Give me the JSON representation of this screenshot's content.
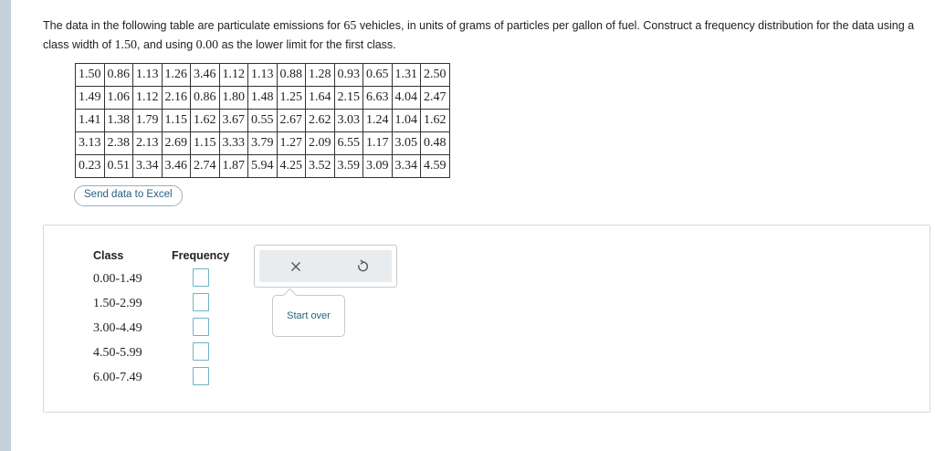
{
  "prompt": {
    "part1": "The data in the following table are particulate emissions for ",
    "count": "65",
    "part2": " vehicles, in units of grams of particles per gallon of fuel. Construct a frequency distribution for the data using a class width of ",
    "width": "1.50",
    "part3": ", and using ",
    "lower": "0.00",
    "part4": " as the lower limit for the first class."
  },
  "table": {
    "rows": [
      [
        "1.50",
        "0.86",
        "1.13",
        "1.26",
        "3.46",
        "1.12",
        "1.13",
        "0.88",
        "1.28",
        "0.93",
        "0.65",
        "1.31",
        "2.50"
      ],
      [
        "1.49",
        "1.06",
        "1.12",
        "2.16",
        "0.86",
        "1.80",
        "1.48",
        "1.25",
        "1.64",
        "2.15",
        "6.63",
        "4.04",
        "2.47"
      ],
      [
        "1.41",
        "1.38",
        "1.79",
        "1.15",
        "1.62",
        "3.67",
        "0.55",
        "2.67",
        "2.62",
        "3.03",
        "1.24",
        "1.04",
        "1.62"
      ],
      [
        "3.13",
        "2.38",
        "2.13",
        "2.69",
        "1.15",
        "3.33",
        "3.79",
        "1.27",
        "2.09",
        "6.55",
        "1.17",
        "3.05",
        "0.48"
      ],
      [
        "0.23",
        "0.51",
        "3.34",
        "3.46",
        "2.74",
        "1.87",
        "5.94",
        "4.25",
        "3.52",
        "3.59",
        "3.09",
        "3.34",
        "4.59"
      ]
    ]
  },
  "excel_button": "Send data to Excel",
  "answer": {
    "class_header": "Class",
    "frequency_header": "Frequency",
    "classes": [
      "0.00-1.49",
      "1.50-2.99",
      "3.00-4.49",
      "4.50-5.99",
      "6.00-7.49"
    ],
    "frequencies": [
      "",
      "",
      "",
      "",
      ""
    ]
  },
  "tools": {
    "clear_icon": "x-icon",
    "undo_icon": "undo-icon",
    "tooltip": "Start over"
  }
}
